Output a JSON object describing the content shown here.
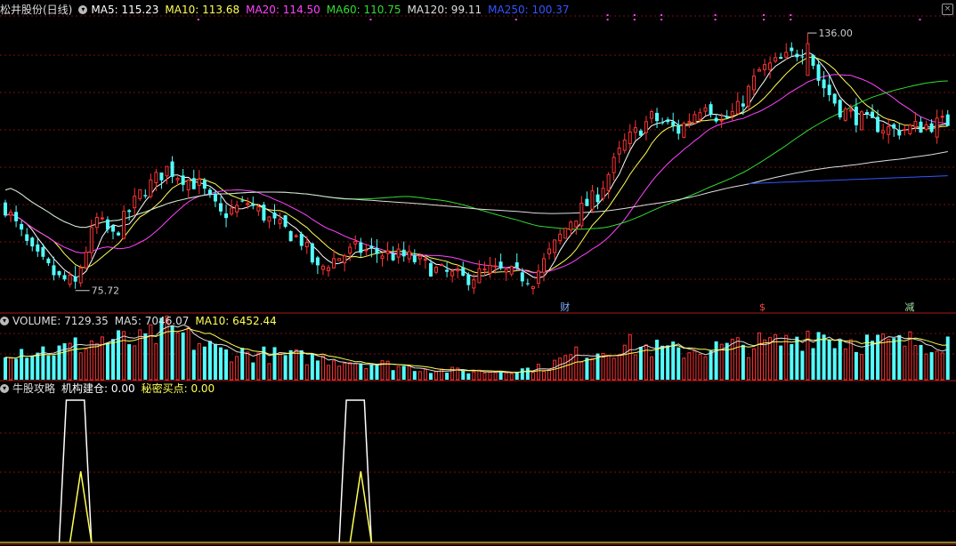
{
  "header": {
    "title": "松井股份(日线)",
    "ma_items": [
      {
        "label": "MA5: 115.23",
        "color": "#ffffff"
      },
      {
        "label": "MA10: 113.68",
        "color": "#ffff55"
      },
      {
        "label": "MA20: 114.50",
        "color": "#ff44ff"
      },
      {
        "label": "MA60: 110.75",
        "color": "#33dd33"
      },
      {
        "label": "MA120: 99.11",
        "color": "#dddddd"
      },
      {
        "label": "MA250: 100.37",
        "color": "#3355ff"
      }
    ]
  },
  "volume_header": {
    "title": "VOLUME: 7129.35",
    "items": [
      {
        "label": "MA5: 7046.07",
        "color": "#dddddd"
      },
      {
        "label": "MA10: 6452.44",
        "color": "#ffff55"
      }
    ]
  },
  "indicator_header": {
    "title": "牛股攻略",
    "items": [
      {
        "label": "机构建仓: 0.00",
        "color": "#ffffff"
      },
      {
        "label": "秘密买点: 0.00",
        "color": "#ffff55"
      }
    ]
  },
  "colors": {
    "up": "#ff3333",
    "down": "#54fcfc",
    "grid": "#7a1010",
    "ma5": "#ffffff",
    "ma10": "#ffff55",
    "ma20": "#ff44ff",
    "ma60": "#33dd33",
    "ma120": "#dddddd",
    "ma250": "#3355ff"
  },
  "chart_data": [
    {
      "type": "candlestick",
      "title": "松井股份(日线)",
      "ylim": [
        70,
        140
      ],
      "price_labels": {
        "high": "136.00",
        "low": "75.72"
      },
      "high_point": {
        "value": 136.0
      },
      "low_point": {
        "value": 75.72
      },
      "event_markers": [
        "财",
        "$",
        "减"
      ],
      "anchors": [
        [
          0,
          95
        ],
        [
          5,
          84
        ],
        [
          10,
          78
        ],
        [
          13,
          77
        ],
        [
          15,
          85
        ],
        [
          17,
          92
        ],
        [
          20,
          88
        ],
        [
          25,
          98
        ],
        [
          30,
          104
        ],
        [
          33,
          102
        ],
        [
          36,
          100
        ],
        [
          40,
          93
        ],
        [
          45,
          96
        ],
        [
          50,
          91
        ],
        [
          55,
          87
        ],
        [
          58,
          80
        ],
        [
          60,
          82
        ],
        [
          65,
          85
        ],
        [
          70,
          84
        ],
        [
          75,
          83
        ],
        [
          80,
          80
        ],
        [
          85,
          78
        ],
        [
          90,
          80
        ],
        [
          95,
          79
        ],
        [
          98,
          78
        ],
        [
          100,
          82
        ],
        [
          105,
          92
        ],
        [
          110,
          98
        ],
        [
          115,
          110
        ],
        [
          120,
          116
        ],
        [
          125,
          113
        ],
        [
          130,
          120
        ],
        [
          133,
          115
        ],
        [
          136,
          118
        ],
        [
          140,
          127
        ],
        [
          145,
          130
        ],
        [
          149,
          133
        ],
        [
          151,
          125
        ],
        [
          155,
          118
        ],
        [
          160,
          115
        ],
        [
          165,
          113
        ],
        [
          170,
          114
        ],
        [
          175,
          115
        ]
      ],
      "series": [
        {
          "name": "MA5",
          "data": "derived from candles"
        },
        {
          "name": "MA10",
          "data": "derived from candles"
        },
        {
          "name": "MA20",
          "data": "derived from candles"
        },
        {
          "name": "MA60",
          "data": "derived from candles"
        },
        {
          "name": "MA120",
          "data": "derived from candles"
        },
        {
          "name": "MA250",
          "data": "derived from candles"
        }
      ]
    },
    {
      "type": "bar",
      "title": "VOLUME: 7129.35",
      "anchors": [
        [
          0,
          5400
        ],
        [
          10,
          5200
        ],
        [
          18,
          7000
        ],
        [
          25,
          6500
        ],
        [
          30,
          8500
        ],
        [
          40,
          5000
        ],
        [
          55,
          4000
        ],
        [
          65,
          3300
        ],
        [
          80,
          1800
        ],
        [
          90,
          1500
        ],
        [
          100,
          2200
        ],
        [
          105,
          4200
        ],
        [
          115,
          6000
        ],
        [
          125,
          5000
        ],
        [
          135,
          5800
        ],
        [
          145,
          6500
        ],
        [
          150,
          8500
        ],
        [
          155,
          7000
        ],
        [
          165,
          6200
        ],
        [
          175,
          7129
        ]
      ],
      "series": [
        {
          "name": "MA5"
        },
        {
          "name": "MA10"
        }
      ]
    },
    {
      "type": "line",
      "title": "牛股攻略",
      "series": [
        {
          "name": "机构建仓",
          "color": "#ffffff",
          "pulses": [
            [
              11,
              15
            ],
            [
              63,
              67
            ]
          ]
        },
        {
          "name": "秘密买点",
          "color": "#ffff55",
          "pulses": [
            [
              13,
              15
            ],
            [
              65,
              67
            ]
          ]
        }
      ]
    }
  ]
}
